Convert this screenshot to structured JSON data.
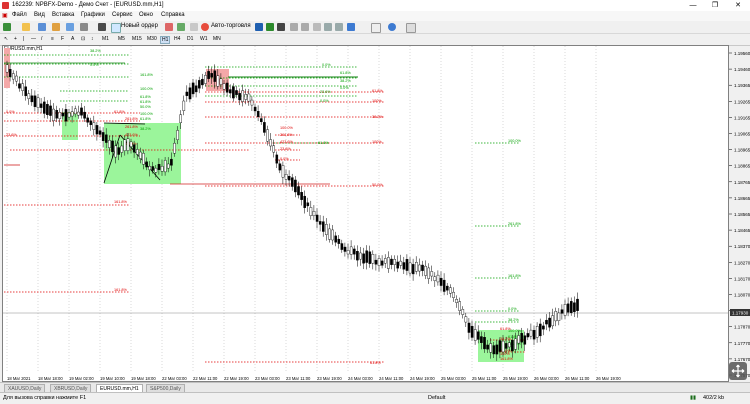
{
  "window": {
    "title": "162239: NPBFX-Demo - Демо Счет - [EURUSD.mm,H1]",
    "minimize": "—",
    "maximize": "❐",
    "close": "✕"
  },
  "menu": [
    "Файл",
    "Вид",
    "Вставка",
    "Графики",
    "Сервис",
    "Окно",
    "Справка"
  ],
  "toolbar": {
    "new_order": "Новый ордер",
    "auto_trading": "Авто-торговля"
  },
  "timeframes": [
    "M1",
    "M5",
    "M15",
    "M30",
    "H1",
    "H4",
    "D1",
    "W1",
    "MN"
  ],
  "active_timeframe": "H1",
  "chart": {
    "label": "EURUSD.mm,H1",
    "current_price": "1.17930",
    "price_ticks": [
      "1.19560",
      "1.19460",
      "1.19365",
      "1.19265",
      "1.19165",
      "1.19065",
      "1.18965",
      "1.18865",
      "1.18765",
      "1.18665",
      "1.18565",
      "1.18465",
      "1.18370",
      "1.18270",
      "1.18170",
      "1.18070",
      "1.17970",
      "1.17870",
      "1.17770",
      "1.17670",
      "1.17570"
    ],
    "time_ticks": [
      "18 Mar 2021",
      "18 Mar 18:00",
      "19 Mar 02:00",
      "19 Mar 10:00",
      "19 Mar 18:00",
      "22 Mar 03:00",
      "22 Mar 11:00",
      "22 Mar 19:00",
      "23 Mar 03:00",
      "23 Mar 11:00",
      "23 Mar 19:00",
      "24 Mar 03:00",
      "24 Mar 11:00",
      "24 Mar 19:00",
      "25 Mar 03:00",
      "25 Mar 11:00",
      "25 Mar 19:00",
      "26 Mar 03:00",
      "26 Mar 11:00",
      "26 Mar 19:00"
    ],
    "fib_green": [
      "38.2%",
      "0.0%",
      "161.8%",
      "100.0%",
      "61.8%",
      "0.0%",
      "61.8%",
      "38.2%",
      "0.0%",
      "61.8%",
      "50.0%",
      "100.0%",
      "61.8%",
      "38.2%",
      "23.6%",
      "0.0%",
      "61.8%",
      "100.0%",
      "261.8%",
      "161.8%",
      "0.0%",
      "38.2%",
      "100.0%",
      "61.8%",
      "161.8%"
    ],
    "fib_red": [
      "61.8%",
      "100%",
      "38.2%",
      "100%",
      "50.0%",
      "23.6%",
      "0.0%",
      "61.8%",
      "161.8%",
      "161.8%",
      "100.0%",
      "261.8%",
      "423.6%",
      "23.6%",
      "0.0%",
      "61.8%",
      "38.2%",
      "50.0%",
      "61.8%",
      "100%",
      "161.8%",
      "261.8%",
      "261.8%",
      "423.6%",
      "1100%"
    ],
    "colors": {
      "bull_zone": "#9bf59b",
      "bear_zone": "#f4a8a8",
      "fib_green": "#00a000",
      "fib_red": "#e00000",
      "grid": "#bfbfbf"
    }
  },
  "tabs": [
    "XAUUSD,Daily",
    "XBRUSD,Daily",
    "EURUSD.mm,H1",
    "S&P500,Daily"
  ],
  "active_tab": "EURUSD.mm,H1",
  "status": {
    "help": "Для вызова справки нажмите F1",
    "profile": "Default",
    "traffic": "402/2 kb"
  }
}
